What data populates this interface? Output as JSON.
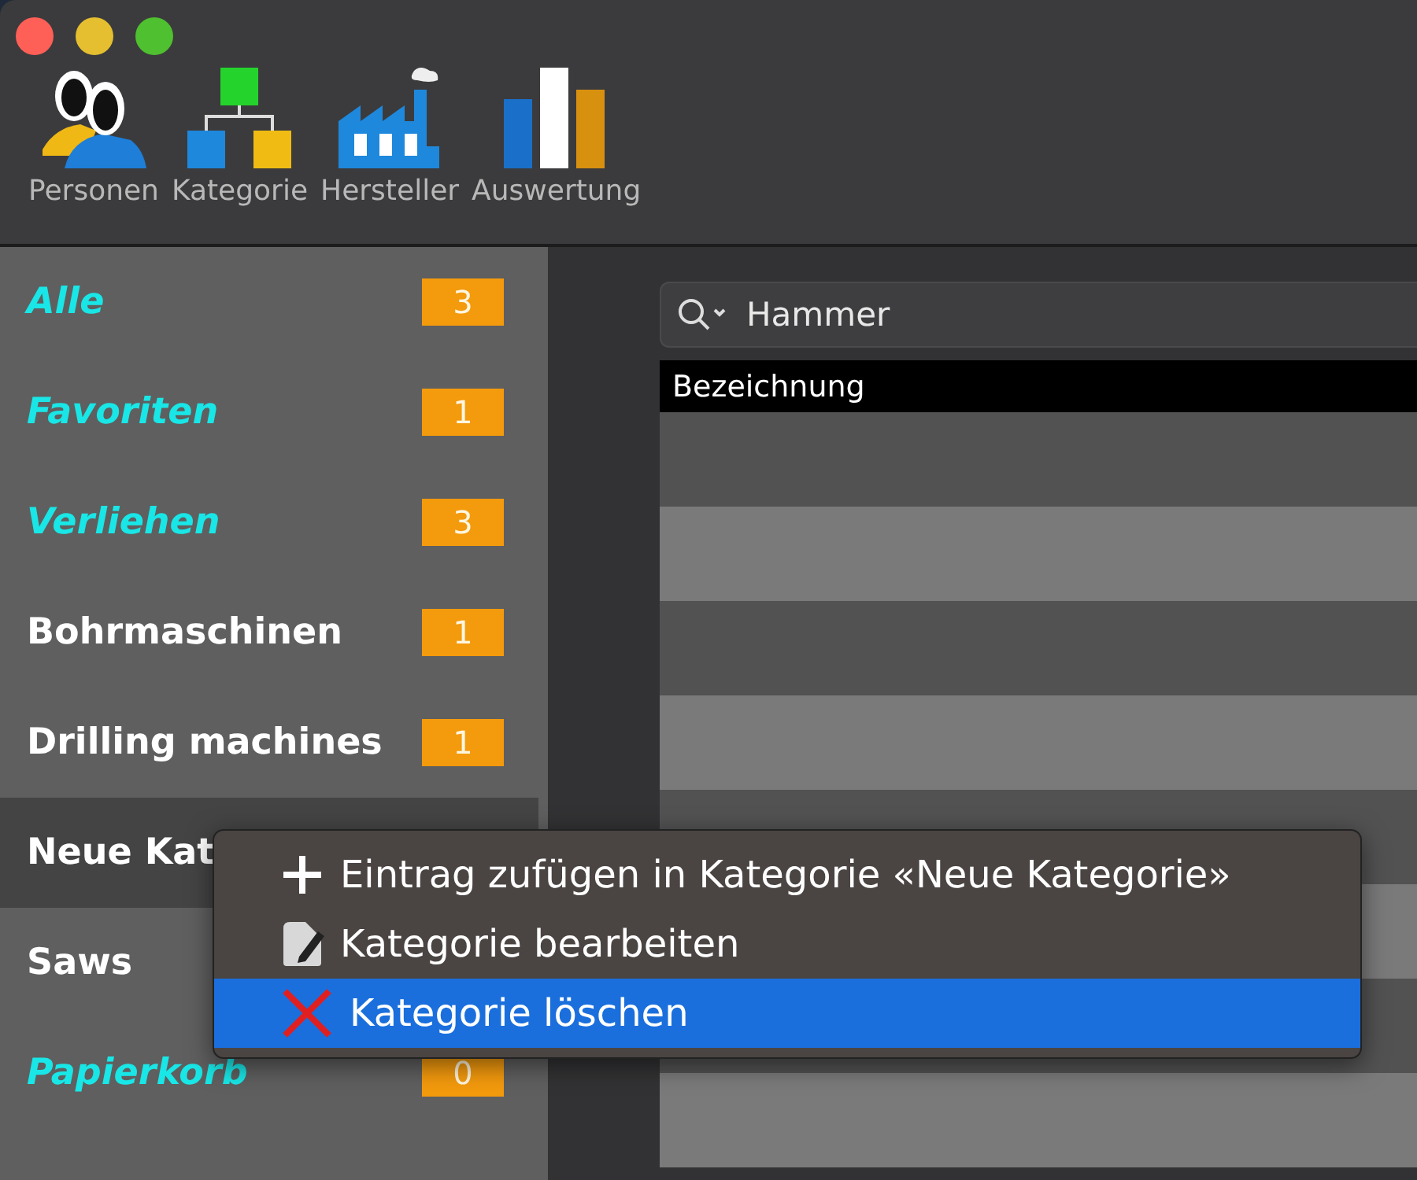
{
  "toolbar": [
    {
      "label": "Personen",
      "kind": "people"
    },
    {
      "label": "Kategorie",
      "kind": "hierarchy"
    },
    {
      "label": "Hersteller",
      "kind": "factory"
    },
    {
      "label": "Auswertung",
      "kind": "chart"
    }
  ],
  "sidebar": {
    "items": [
      {
        "label": "Alle",
        "kind": "smart",
        "count": "3",
        "selected": false
      },
      {
        "label": "Favoriten",
        "kind": "smart",
        "count": "1",
        "selected": false
      },
      {
        "label": "Verliehen",
        "kind": "smart",
        "count": "3",
        "selected": false
      },
      {
        "label": "Bohrmaschinen",
        "kind": "category",
        "count": "1",
        "selected": false
      },
      {
        "label": "Drilling machines",
        "kind": "category",
        "count": "1",
        "selected": false
      },
      {
        "label": "Neue Kat",
        "kind": "category",
        "selected": true
      },
      {
        "label": "Saws",
        "kind": "category",
        "selected": false
      },
      {
        "label": "Papierkorb",
        "kind": "smart",
        "count": "0",
        "selected": false
      }
    ]
  },
  "search": {
    "value": "Hammer"
  },
  "table": {
    "columns": [
      "Bezeichnung"
    ]
  },
  "context_menu": {
    "items": [
      {
        "label": "Eintrag zufügen in Kategorie «Neue Kategorie»",
        "kind": "add",
        "selected": false
      },
      {
        "label": "Kategorie bearbeiten",
        "kind": "edit",
        "selected": false
      },
      {
        "label": "Kategorie löschen",
        "kind": "delete",
        "selected": true
      }
    ]
  }
}
